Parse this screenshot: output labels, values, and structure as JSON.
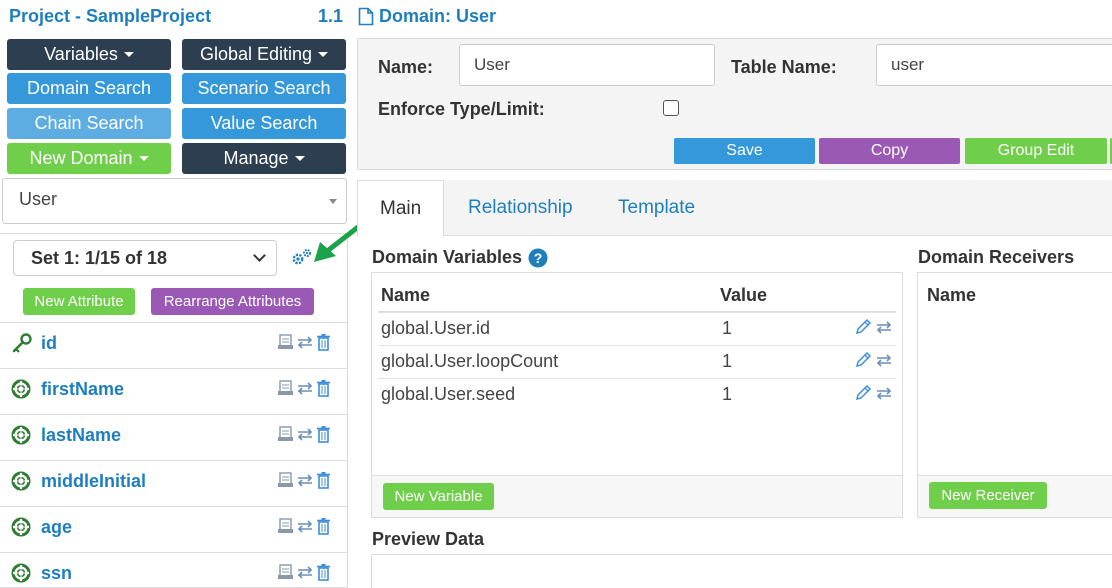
{
  "header": {
    "project_title": "Project - SampleProject",
    "version": "1.1",
    "domain_title": "Domain: User"
  },
  "menu": {
    "variables": "Variables",
    "global_editing": "Global Editing",
    "domain_search": "Domain Search",
    "scenario_search": "Scenario Search",
    "chain_search": "Chain Search",
    "value_search": "Value Search",
    "new_domain": "New Domain",
    "manage": "Manage"
  },
  "domain_select": {
    "value": "User"
  },
  "attributes": {
    "set_select": "Set 1: 1/15 of 18",
    "new_attribute": "New Attribute",
    "rearrange": "Rearrange Attributes",
    "items": [
      {
        "label": "id",
        "icon": "key-icon"
      },
      {
        "label": "firstName",
        "icon": "lifebuoy-icon"
      },
      {
        "label": "lastName",
        "icon": "lifebuoy-icon"
      },
      {
        "label": "middleInitial",
        "icon": "lifebuoy-icon"
      },
      {
        "label": "age",
        "icon": "lifebuoy-icon"
      },
      {
        "label": "ssn",
        "icon": "lifebuoy-icon"
      }
    ]
  },
  "form": {
    "name_label": "Name:",
    "name_value": "User",
    "table_label": "Table Name:",
    "table_value": "user",
    "enforce_label": "Enforce Type/Limit:",
    "save": "Save",
    "copy": "Copy",
    "group_edit": "Group Edit"
  },
  "tabs": [
    "Main",
    "Relationship",
    "Template"
  ],
  "domain_variables": {
    "title": "Domain Variables",
    "col_name": "Name",
    "col_value": "Value",
    "rows": [
      {
        "name": "global.User.id",
        "value": "1"
      },
      {
        "name": "global.User.loopCount",
        "value": "1"
      },
      {
        "name": "global.User.seed",
        "value": "1"
      }
    ],
    "new_variable": "New Variable"
  },
  "domain_receivers": {
    "title": "Domain Receivers",
    "col_name": "Name",
    "new_receiver": "New Receiver"
  },
  "preview": {
    "title": "Preview Data"
  },
  "colors": {
    "accent": "#1f7fbd",
    "dark_button": "#2c3e50",
    "blue_button": "#3498db",
    "green_button": "#6fcf4a",
    "purple_button": "#9b59b6",
    "arrow": "#1aa34a"
  }
}
